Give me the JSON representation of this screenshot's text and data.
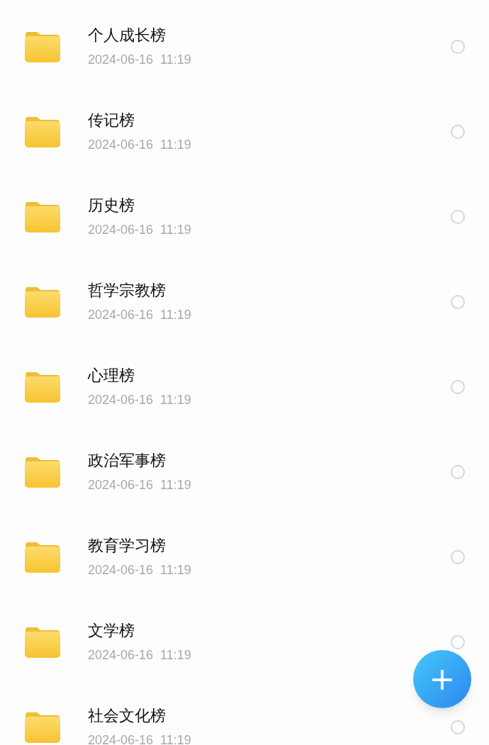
{
  "folders": [
    {
      "name": "个人成长榜",
      "modified": "2024-06-16  11:19",
      "selected": false
    },
    {
      "name": "传记榜",
      "modified": "2024-06-16  11:19",
      "selected": false
    },
    {
      "name": "历史榜",
      "modified": "2024-06-16  11:19",
      "selected": false
    },
    {
      "name": "哲学宗教榜",
      "modified": "2024-06-16  11:19",
      "selected": false
    },
    {
      "name": "心理榜",
      "modified": "2024-06-16  11:19",
      "selected": false
    },
    {
      "name": "政治军事榜",
      "modified": "2024-06-16  11:19",
      "selected": false
    },
    {
      "name": "教育学习榜",
      "modified": "2024-06-16  11:19",
      "selected": false
    },
    {
      "name": "文学榜",
      "modified": "2024-06-16  11:19",
      "selected": false
    },
    {
      "name": "社会文化榜",
      "modified": "2024-06-16  11:19",
      "selected": false
    }
  ],
  "fab": {
    "label": "+"
  }
}
